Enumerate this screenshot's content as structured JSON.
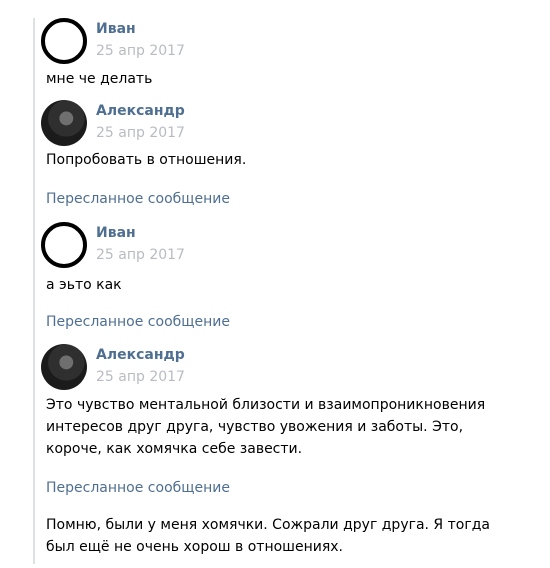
{
  "messages": [
    {
      "author": "Иван",
      "date": "25 апр 2017",
      "text": "мне че делать"
    },
    {
      "author": "Александр",
      "date": "25 апр 2017",
      "text": "Попробовать в отношения."
    },
    {
      "author": "Иван",
      "date": "25 апр 2017",
      "text": "а эьто как"
    },
    {
      "author": "Александр",
      "date": "25 апр 2017",
      "text_lines": [
        "Это чувство ментальной близости и взаимопроникновения",
        "интересов друг друга, чувство увожения и заботы. Это,",
        "короче, как хомячка себе завести."
      ]
    }
  ],
  "forwarded_label": "Пересланное сообщение",
  "final": {
    "text_lines": [
      "Помню, были у меня хомячки. Сожрали друг друга. Я тогда",
      "был ещё не очень хорош в отношениях."
    ]
  }
}
